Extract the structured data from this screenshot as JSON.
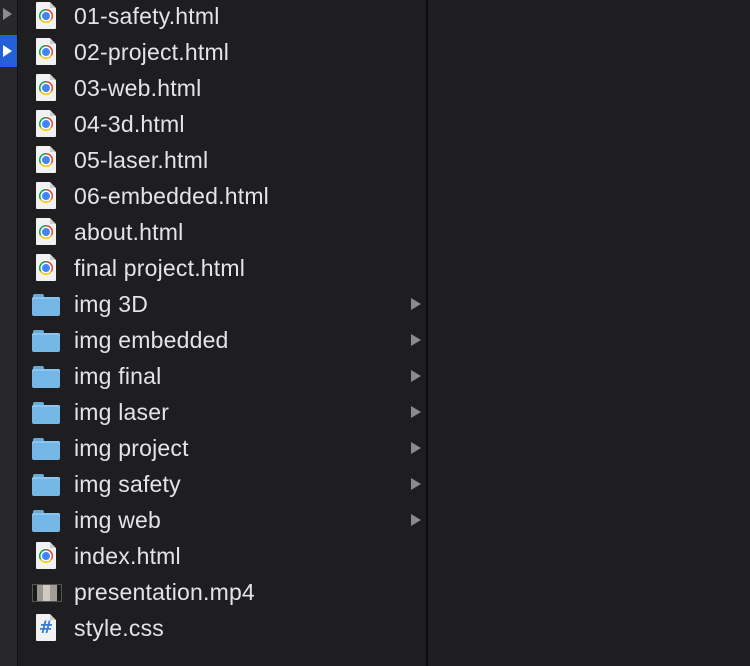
{
  "files": [
    {
      "name": "01-safety.html",
      "icon": "chrome-html-file-icon",
      "type": "html",
      "folder": false
    },
    {
      "name": "02-project.html",
      "icon": "chrome-html-file-icon",
      "type": "html",
      "folder": false
    },
    {
      "name": "03-web.html",
      "icon": "chrome-html-file-icon",
      "type": "html",
      "folder": false
    },
    {
      "name": "04-3d.html",
      "icon": "chrome-html-file-icon",
      "type": "html",
      "folder": false
    },
    {
      "name": "05-laser.html",
      "icon": "chrome-html-file-icon",
      "type": "html",
      "folder": false
    },
    {
      "name": "06-embedded.html",
      "icon": "chrome-html-file-icon",
      "type": "html",
      "folder": false
    },
    {
      "name": "about.html",
      "icon": "chrome-html-file-icon",
      "type": "html",
      "folder": false
    },
    {
      "name": "final project.html",
      "icon": "chrome-html-file-icon",
      "type": "html",
      "folder": false
    },
    {
      "name": "img 3D",
      "icon": "folder-icon",
      "type": "folder",
      "folder": true
    },
    {
      "name": "img embedded",
      "icon": "folder-icon",
      "type": "folder",
      "folder": true
    },
    {
      "name": "img final",
      "icon": "folder-icon",
      "type": "folder",
      "folder": true
    },
    {
      "name": "img laser",
      "icon": "folder-icon",
      "type": "folder",
      "folder": true
    },
    {
      "name": "img project",
      "icon": "folder-icon",
      "type": "folder",
      "folder": true
    },
    {
      "name": "img safety",
      "icon": "folder-icon",
      "type": "folder",
      "folder": true
    },
    {
      "name": "img web",
      "icon": "folder-icon",
      "type": "folder",
      "folder": true
    },
    {
      "name": "index.html",
      "icon": "chrome-html-file-icon",
      "type": "html",
      "folder": false
    },
    {
      "name": "presentation.mp4",
      "icon": "video-thumbnail-icon",
      "type": "video",
      "folder": false
    },
    {
      "name": "style.css",
      "icon": "css-file-icon",
      "type": "css",
      "folder": false
    }
  ],
  "colors": {
    "background": "#1e1e21",
    "text": "#e4e4e6",
    "selection": "#2461d9",
    "folder": "#74b6e5",
    "chevron": "#8a8a8d"
  }
}
